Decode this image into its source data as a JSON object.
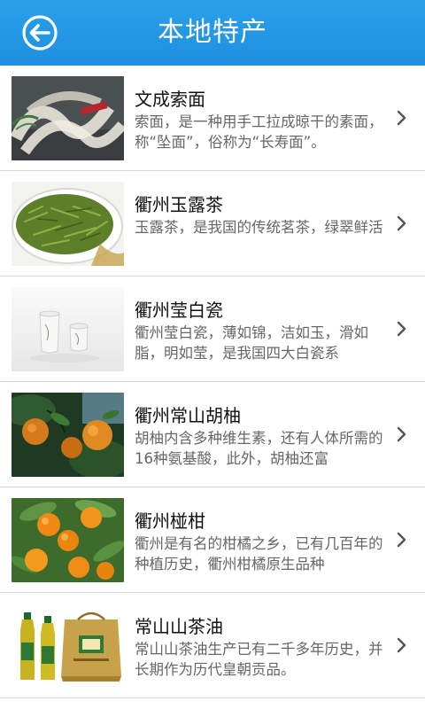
{
  "header": {
    "title": "本地特产",
    "back_icon": "back-arrow-circle-icon",
    "background": "#1e8fe0"
  },
  "list": {
    "items": [
      {
        "title": "文成索面",
        "desc": "索面，是一种用手工拉成晾干的素面，称“坠面”，俗称为“长寿面”。",
        "image": "noodles-photo"
      },
      {
        "title": "衢州玉露茶",
        "desc": "玉露茶，是我国的传统茗茶，绿翠鲜活",
        "image": "green-tea-photo"
      },
      {
        "title": "衢州莹白瓷",
        "desc": "衢州莹白瓷，薄如锦，洁如玉，滑如脂，明如莹，是我国四大白瓷系",
        "image": "white-porcelain-photo"
      },
      {
        "title": "衢州常山胡柚",
        "desc": "胡柚内含多种维生素，还有人体所需的16种氨基酸，此外，胡柚还富",
        "image": "huyou-fruit-photo"
      },
      {
        "title": "衢州椪柑",
        "desc": "衢州是有名的柑橘之乡，已有几百年的种植历史，衢州柑橘原生品种",
        "image": "ponkan-tangerine-photo"
      },
      {
        "title": "常山山茶油",
        "desc": "常山山茶油生产已有二千多年历史，并长期作为历代皇朝贡品。",
        "image": "camellia-oil-photo"
      }
    ]
  }
}
